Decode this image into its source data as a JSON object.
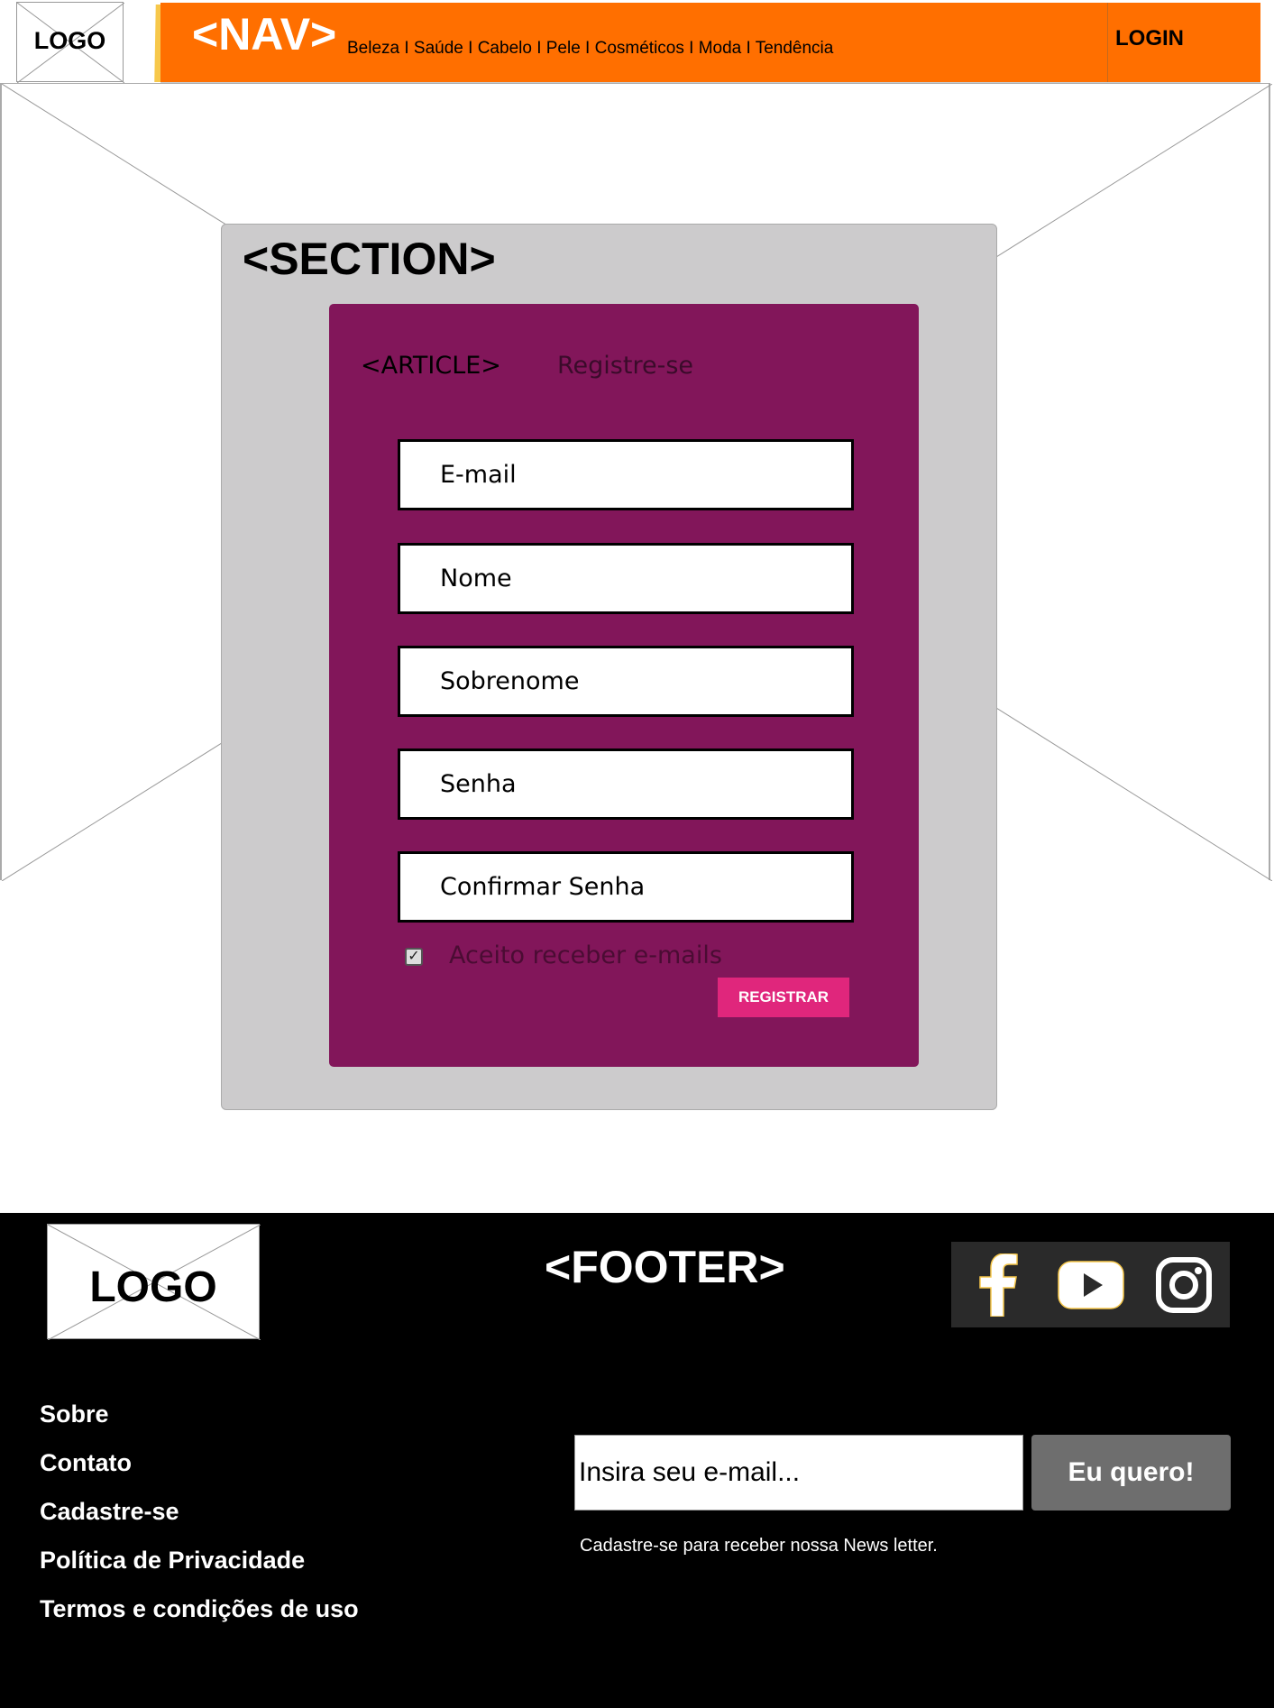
{
  "header": {
    "logo_text": "LOGO",
    "nav_title": "<NAV>",
    "nav_links": "Beleza I Saúde I Cabelo I Pele I Cosméticos I Moda I Tendência",
    "login_label": "LOGIN"
  },
  "section": {
    "title": "<SECTION>",
    "article": {
      "title": "<ARTICLE>",
      "subtitle": "Registre-se",
      "fields": [
        {
          "placeholder": "E-mail"
        },
        {
          "placeholder": "Nome"
        },
        {
          "placeholder": "Sobrenome"
        },
        {
          "placeholder": "Senha"
        },
        {
          "placeholder": "Confirmar Senha"
        }
      ],
      "checkbox_label": "Aceito receber e-mails",
      "checkbox_checked": true,
      "submit_label": "REGISTRAR"
    }
  },
  "footer": {
    "logo_text": "LOGO",
    "title": "<FOOTER>",
    "social_icons": [
      "facebook-icon",
      "youtube-icon",
      "instagram-icon"
    ],
    "links": [
      "Sobre",
      "Contato",
      "Cadastre-se",
      "Política de Privacidade",
      "Termos e condições de uso"
    ],
    "newsletter": {
      "placeholder": "Insira seu e-mail...",
      "button_label": "Eu quero!",
      "note": "Cadastre-se para receber nossa News letter."
    }
  },
  "colors": {
    "nav": "#ff6f00",
    "section": "#cccbcc",
    "article": "#82165a",
    "register_button": "#e0267c",
    "footer": "#000000",
    "newsletter_button": "#6e6e6e"
  }
}
